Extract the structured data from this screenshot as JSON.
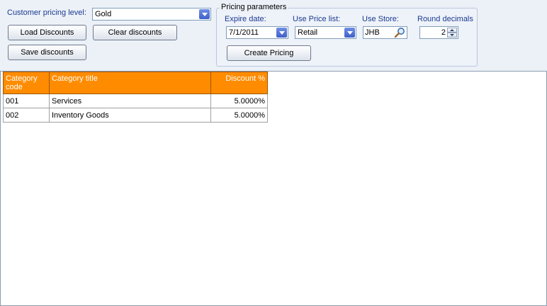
{
  "pricing_level": {
    "label": "Customer pricing level:",
    "value": "Gold"
  },
  "buttons": {
    "load": "Load Discounts",
    "clear": "Clear discounts",
    "save": "Save discounts",
    "create": "Create Pricing"
  },
  "params": {
    "title": "Pricing parameters",
    "expire_label": "Expire date:",
    "expire_value": "7/1/2011",
    "pricelist_label": "Use Price list:",
    "pricelist_value": "Retail",
    "store_label": "Use Store:",
    "store_value": "JHB",
    "round_label": "Round decimals",
    "round_value": "2"
  },
  "grid": {
    "headers": [
      "Category code",
      "Category title",
      "Discount %"
    ],
    "rows": [
      [
        "001",
        "Services",
        "5.0000%"
      ],
      [
        "002",
        "Inventory Goods",
        "5.0000%"
      ]
    ]
  },
  "colors": {
    "header_bg": "#ff8c00",
    "label": "#1a3a8f"
  }
}
